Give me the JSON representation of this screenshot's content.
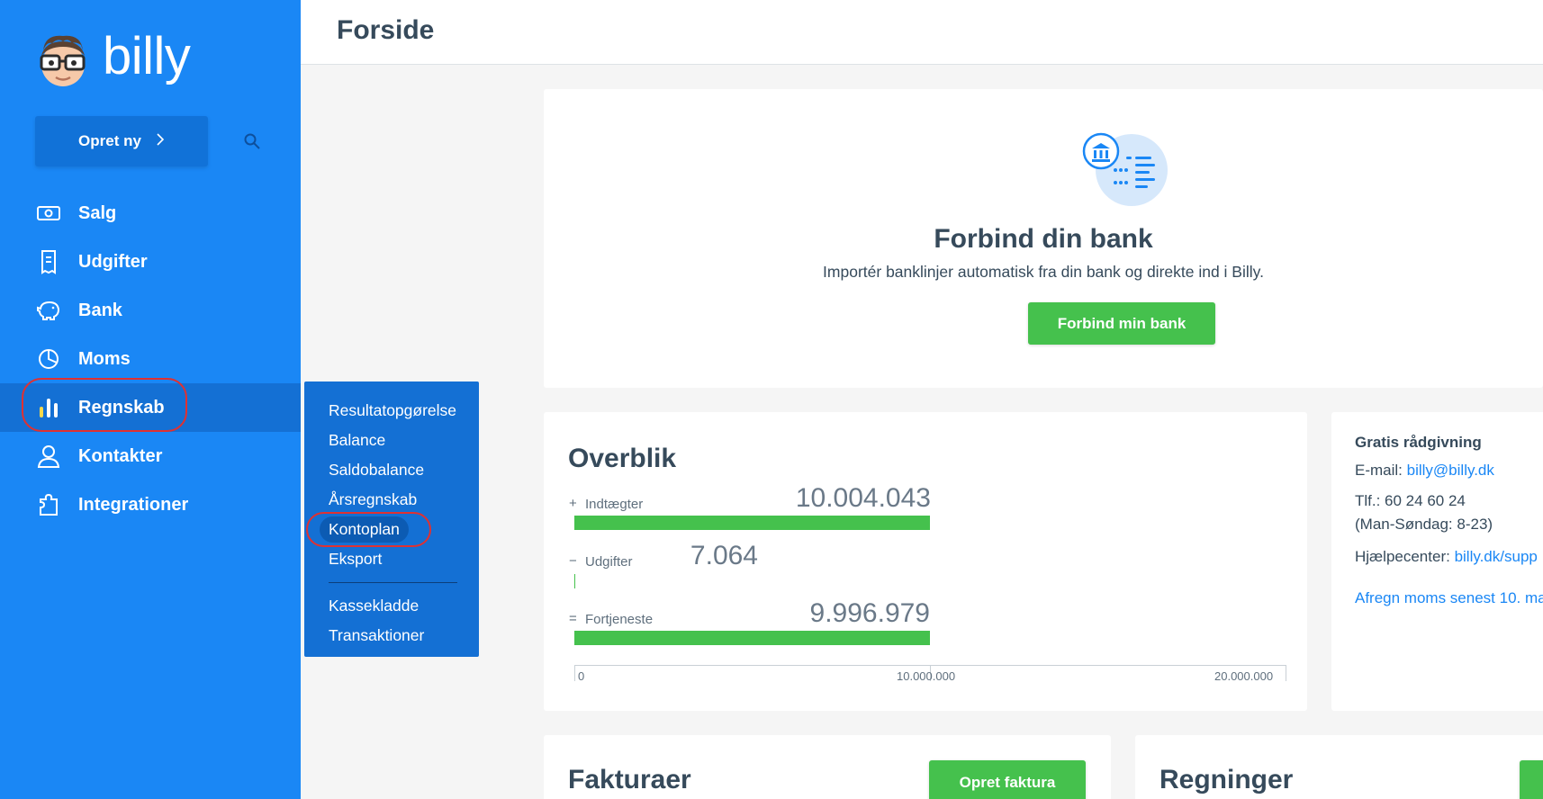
{
  "app": {
    "logo_text": "billy"
  },
  "sidebar": {
    "create_label": "Opret ny",
    "items": [
      {
        "label": "Salg",
        "icon": "money-icon"
      },
      {
        "label": "Udgifter",
        "icon": "receipt-icon"
      },
      {
        "label": "Bank",
        "icon": "piggy-bank-icon"
      },
      {
        "label": "Moms",
        "icon": "pie-chart-icon"
      },
      {
        "label": "Regnskab",
        "icon": "bar-chart-icon"
      },
      {
        "label": "Kontakter",
        "icon": "person-icon"
      },
      {
        "label": "Integrationer",
        "icon": "puzzle-icon"
      }
    ],
    "active_item": "Regnskab"
  },
  "submenu": {
    "items": [
      "Resultatopgørelse",
      "Balance",
      "Saldobalance",
      "Årsregnskab",
      "Kontoplan",
      "Eksport"
    ],
    "items_after_divider": [
      "Kassekladde",
      "Transaktioner"
    ],
    "highlighted": "Kontoplan"
  },
  "header": {
    "title": "Forside"
  },
  "bank_card": {
    "title": "Forbind din bank",
    "subtitle": "Importér banklinjer automatisk fra din bank og direkte ind i Billy.",
    "button_label": "Forbind min bank"
  },
  "overview": {
    "title": "Overblik",
    "rows": [
      {
        "sign": "+",
        "label": "Indtægter",
        "value": "10.004.043",
        "amount": 10004043
      },
      {
        "sign": "−",
        "label": "Udgifter",
        "value": "7.064",
        "amount": 7064
      },
      {
        "sign": "=",
        "label": "Fortjeneste",
        "value": "9.996.979",
        "amount": 9996979
      }
    ],
    "axis_ticks": [
      "0",
      "10.000.000",
      "20.000.000"
    ],
    "axis_max": 20000000
  },
  "info": {
    "heading": "Gratis rådgivning",
    "email_label": "E-mail:",
    "email": "billy@billy.dk",
    "phone": "Tlf.: 60 24 60 24",
    "hours": "(Man-Søndag: 8-23)",
    "help_label": "Hjælpecenter:",
    "help_link": "billy.dk/supp",
    "vat_link": "Afregn moms senest 10. ma"
  },
  "invoices": {
    "title": "Fakturaer",
    "button_label": "Opret faktura"
  },
  "bills": {
    "title": "Regninger"
  },
  "colors": {
    "sidebar": "#1a87f5",
    "active": "#1470d4",
    "green": "#45c14d",
    "ring": "#e03131"
  }
}
